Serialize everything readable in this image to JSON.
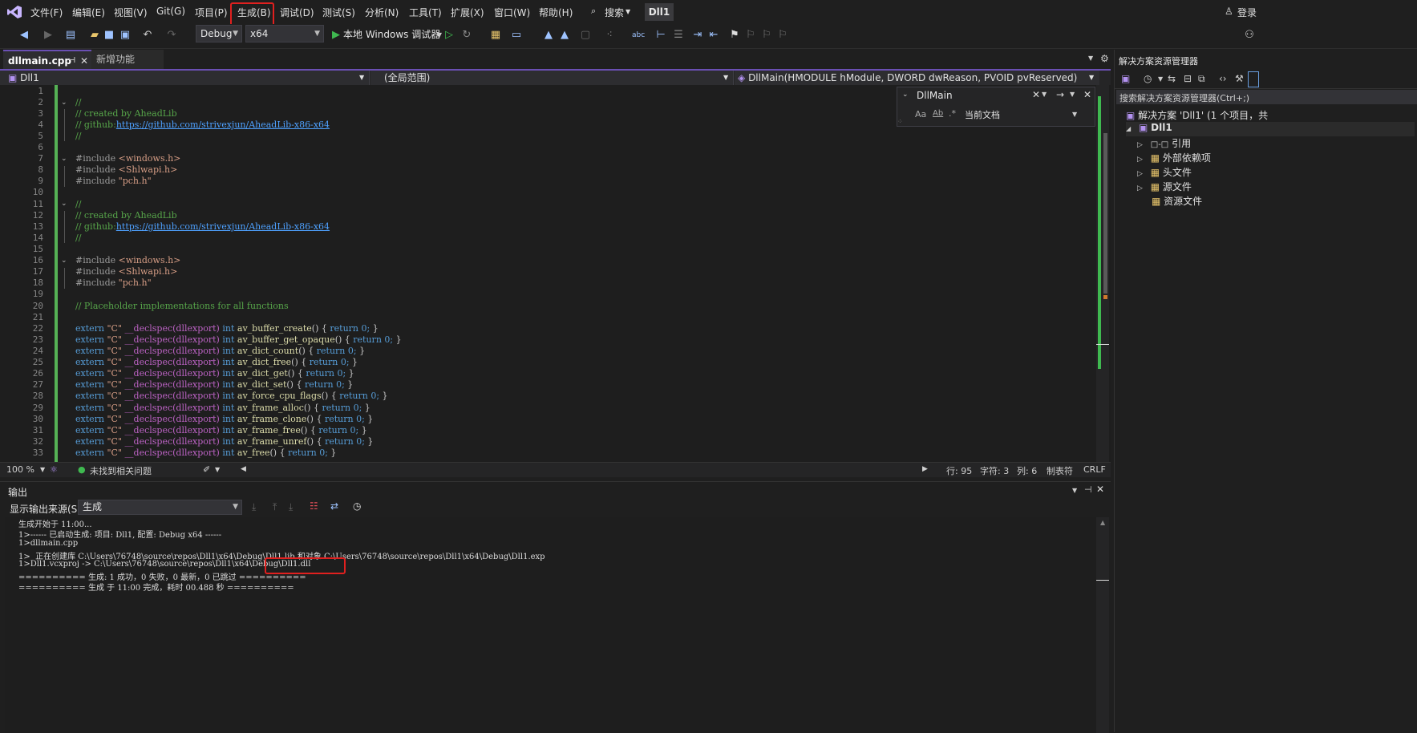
{
  "menubar": {
    "items": [
      "文件(F)",
      "编辑(E)",
      "视图(V)",
      "Git(G)",
      "项目(P)",
      "生成(B)",
      "调试(D)",
      "测试(S)",
      "分析(N)",
      "工具(T)",
      "扩展(X)",
      "窗口(W)",
      "帮助(H)"
    ],
    "search_label": "搜索",
    "solution_name": "Dll1",
    "login_label": "登录"
  },
  "toolbar": {
    "config": "Debug",
    "platform": "x64",
    "run_label": "本地 Windows 调试器"
  },
  "tabs": [
    {
      "label": "dllmain.cpp",
      "active": true
    },
    {
      "label": "新增功能",
      "active": false
    }
  ],
  "navbar": {
    "project": "Dll1",
    "scope": "(全局范围)",
    "member": "DllMain(HMODULE hModule, DWORD dwReason, PVOID pvReserved)"
  },
  "find": {
    "query": "DllMain",
    "scope": "当前文档",
    "opt_case": "Aa",
    "opt_word": "Ab"
  },
  "editor": {
    "line_numbers": [
      "1",
      "2",
      "3",
      "4",
      "5",
      "6",
      "7",
      "8",
      "9",
      "10",
      "11",
      "12",
      "13",
      "14",
      "15",
      "16",
      "17",
      "18",
      "19",
      "20",
      "21",
      "22",
      "23",
      "24",
      "25",
      "26",
      "27",
      "28",
      "29",
      "30",
      "31",
      "32",
      "33"
    ]
  },
  "code": {
    "c2": "//",
    "c3": "// created by AheadLib",
    "c4a": "// github:",
    "c4b": "https://github.com/strivexjun/AheadLib-x86-x64",
    "c5": "//",
    "c7a": "#include ",
    "c7b": "<windows.h>",
    "c8a": "#include ",
    "c8b": "<Shlwapi.h>",
    "c9a": "#include ",
    "c9b": "\"pch.h\"",
    "c11": "//",
    "c12": "// created by AheadLib",
    "c13a": "// github:",
    "c13b": "https://github.com/strivexjun/AheadLib-x86-x64",
    "c14": "//",
    "c16a": "#include ",
    "c16b": "<windows.h>",
    "c17a": "#include ",
    "c17b": "<Shlwapi.h>",
    "c18a": "#include ",
    "c18b": "\"pch.h\"",
    "c20": "// Placeholder implementations for all functions",
    "ext_kw": "extern",
    "ext_c": "\"C\"",
    "ext_decl": "__declspec(dllexport)",
    "ext_int": "int",
    "ret": "return 0;",
    "funcs": [
      "av_buffer_create",
      "av_buffer_get_opaque",
      "av_dict_count",
      "av_dict_free",
      "av_dict_get",
      "av_dict_set",
      "av_force_cpu_flags",
      "av_frame_alloc",
      "av_frame_clone",
      "av_frame_free",
      "av_frame_unref",
      "av_free"
    ]
  },
  "status": {
    "zoom": "100 %",
    "issues": "未找到相关问题",
    "line": "行: 95",
    "char": "字符: 3",
    "col": "列: 6",
    "tabs": "制表符",
    "eol": "CRLF"
  },
  "output": {
    "title": "输出",
    "source_label": "显示输出来源(S):",
    "source_value": "生成",
    "lines": [
      "生成开始于 11:00...",
      "1>------ 已启动生成: 项目: Dll1, 配置: Debug x64 ------",
      "1>dllmain.cpp",
      "1>  正在创建库 C:\\Users\\76748\\source\\repos\\Dll1\\x64\\Debug\\Dll1.lib 和对象 C:\\Users\\76748\\source\\repos\\Dll1\\x64\\Debug\\Dll1.exp",
      "1>Dll1.vcxproj -> C:\\Users\\76748\\source\\repos\\Dll1\\x64\\Debug\\Dll1.dll",
      "========== 生成: 1 成功，0 失败，0 最新，0 已跳过 ==========",
      "========== 生成 于 11:00 完成，耗时 00.488 秒 =========="
    ]
  },
  "solution": {
    "title": "解决方案资源管理器",
    "search_placeholder": "搜索解决方案资源管理器(Ctrl+;)",
    "root": "解决方案 'Dll1' (1 个项目，共",
    "project": "Dll1",
    "items": [
      "引用",
      "外部依赖项",
      "头文件",
      "源文件",
      "资源文件"
    ]
  },
  "colors": {
    "accent": "#6a4fb3",
    "highlight_box": "#e0201f",
    "comment": "#57a64a",
    "keyword": "#569cd6"
  }
}
